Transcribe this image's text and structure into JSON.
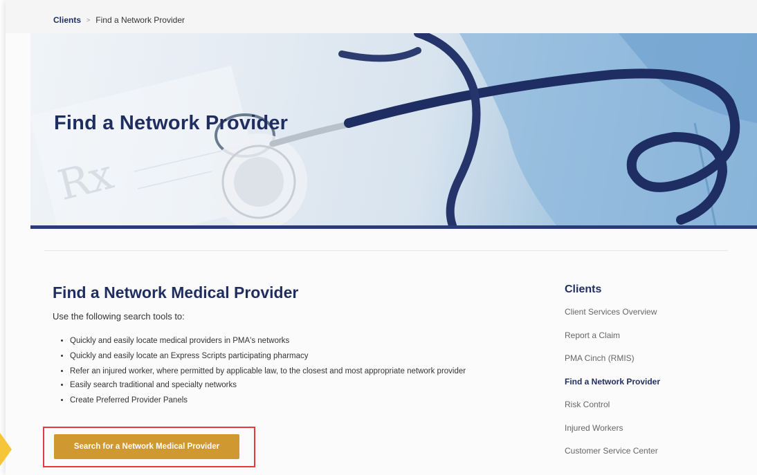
{
  "breadcrumb": {
    "parent": "Clients",
    "separator": ">",
    "current": "Find a Network Provider"
  },
  "hero": {
    "title": "Find a Network Provider",
    "image_subject": "stethoscope and prescription pad",
    "accent_color": "#2b3a78"
  },
  "main": {
    "heading": "Find a Network Medical Provider",
    "intro": "Use the following search tools to:",
    "bullets": [
      "Quickly and easily locate medical providers in PMA's networks",
      "Quickly and easily locate an Express Scripts participating pharmacy",
      "Refer an injured worker, where permitted by applicable law, to the closest and most appropriate network provider",
      "Easily search traditional and specialty networks",
      "Create Preferred Provider Panels"
    ],
    "cta_label": "Search for a Network Medical Provider",
    "cta_color": "#d09830",
    "highlight_color": "#e03a3a"
  },
  "sidebar": {
    "heading": "Clients",
    "items": [
      {
        "label": "Client Services Overview",
        "active": false
      },
      {
        "label": "Report a Claim",
        "active": false
      },
      {
        "label": "PMA Cinch (RMIS)",
        "active": false
      },
      {
        "label": "Find a Network Provider",
        "active": true
      },
      {
        "label": "Risk Control",
        "active": false
      },
      {
        "label": "Injured Workers",
        "active": false
      },
      {
        "label": "Customer Service Center",
        "active": false
      }
    ]
  },
  "colors": {
    "brand_navy": "#1f2d5f",
    "body_text": "#333333",
    "pointer": "#f6c53a"
  }
}
